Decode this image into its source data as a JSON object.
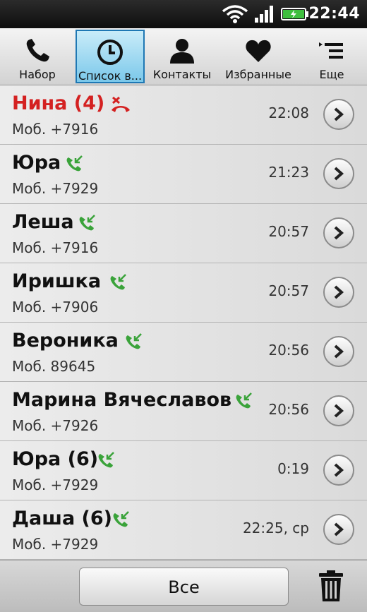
{
  "status_bar": {
    "time": "22:44",
    "icons": [
      "wifi-icon",
      "signal-icon",
      "battery-charging-icon"
    ]
  },
  "tabs": [
    {
      "label": "Набор",
      "icon": "phone-icon"
    },
    {
      "label": "Список в...",
      "icon": "clock-icon",
      "active": true
    },
    {
      "label": "Контакты",
      "icon": "person-icon"
    },
    {
      "label": "Избранные",
      "icon": "heart-icon"
    },
    {
      "label": "Еще",
      "icon": "more-list-icon"
    }
  ],
  "calls": [
    {
      "name": "Нина (4)",
      "type": "missed",
      "number": "Моб. +7916",
      "time": "22:08"
    },
    {
      "name": "Юра",
      "type": "incoming",
      "number": "Моб. +7929",
      "time": "21:23"
    },
    {
      "name": "Леша",
      "type": "incoming",
      "number": "Моб. +7916",
      "time": "20:57"
    },
    {
      "name": "Иришка",
      "type": "incoming",
      "number": "Моб. +7906",
      "time": "20:57"
    },
    {
      "name": "Вероника",
      "type": "incoming",
      "number": "Моб. 89645",
      "time": "20:56"
    },
    {
      "name": "Марина Вячеславовна",
      "type": "incoming",
      "number": "Моб. +7926",
      "time": "20:56"
    },
    {
      "name": "Юра (6)",
      "type": "incoming",
      "number": "Моб. +7929",
      "time": "0:19"
    },
    {
      "name": "Даша (6)",
      "type": "incoming",
      "number": "Моб. +7929",
      "time": "22:25, ср"
    }
  ],
  "colors": {
    "missed": "#d42121",
    "incoming": "#3aa33a",
    "active_tab": "#7bc8ea"
  },
  "bottom_bar": {
    "filter_label": "Все",
    "delete_icon": "trash-icon"
  }
}
